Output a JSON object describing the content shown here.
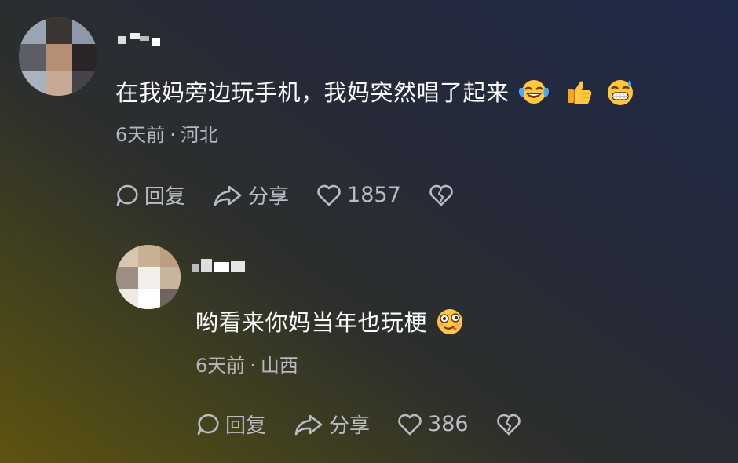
{
  "comments": [
    {
      "text": "在我妈旁边玩手机，我妈突然唱了起来",
      "emojis": [
        "tears-of-joy-emoji",
        "thumbs-up-emoji",
        "grinning-sweat-emoji"
      ],
      "time": "6天前",
      "location": "河北",
      "reply_label": "回复",
      "share_label": "分享",
      "likes": "1857"
    },
    {
      "text": "哟看来你妈当年也玩梗",
      "emojis": [
        "woozy-face-emoji"
      ],
      "time": "6天前",
      "location": "山西",
      "reply_label": "回复",
      "share_label": "分享",
      "likes": "386"
    }
  ],
  "separator": "·",
  "colors": {
    "text": "#ffffff",
    "meta": "#b5b8c2",
    "icon": "#b9bcc6"
  }
}
